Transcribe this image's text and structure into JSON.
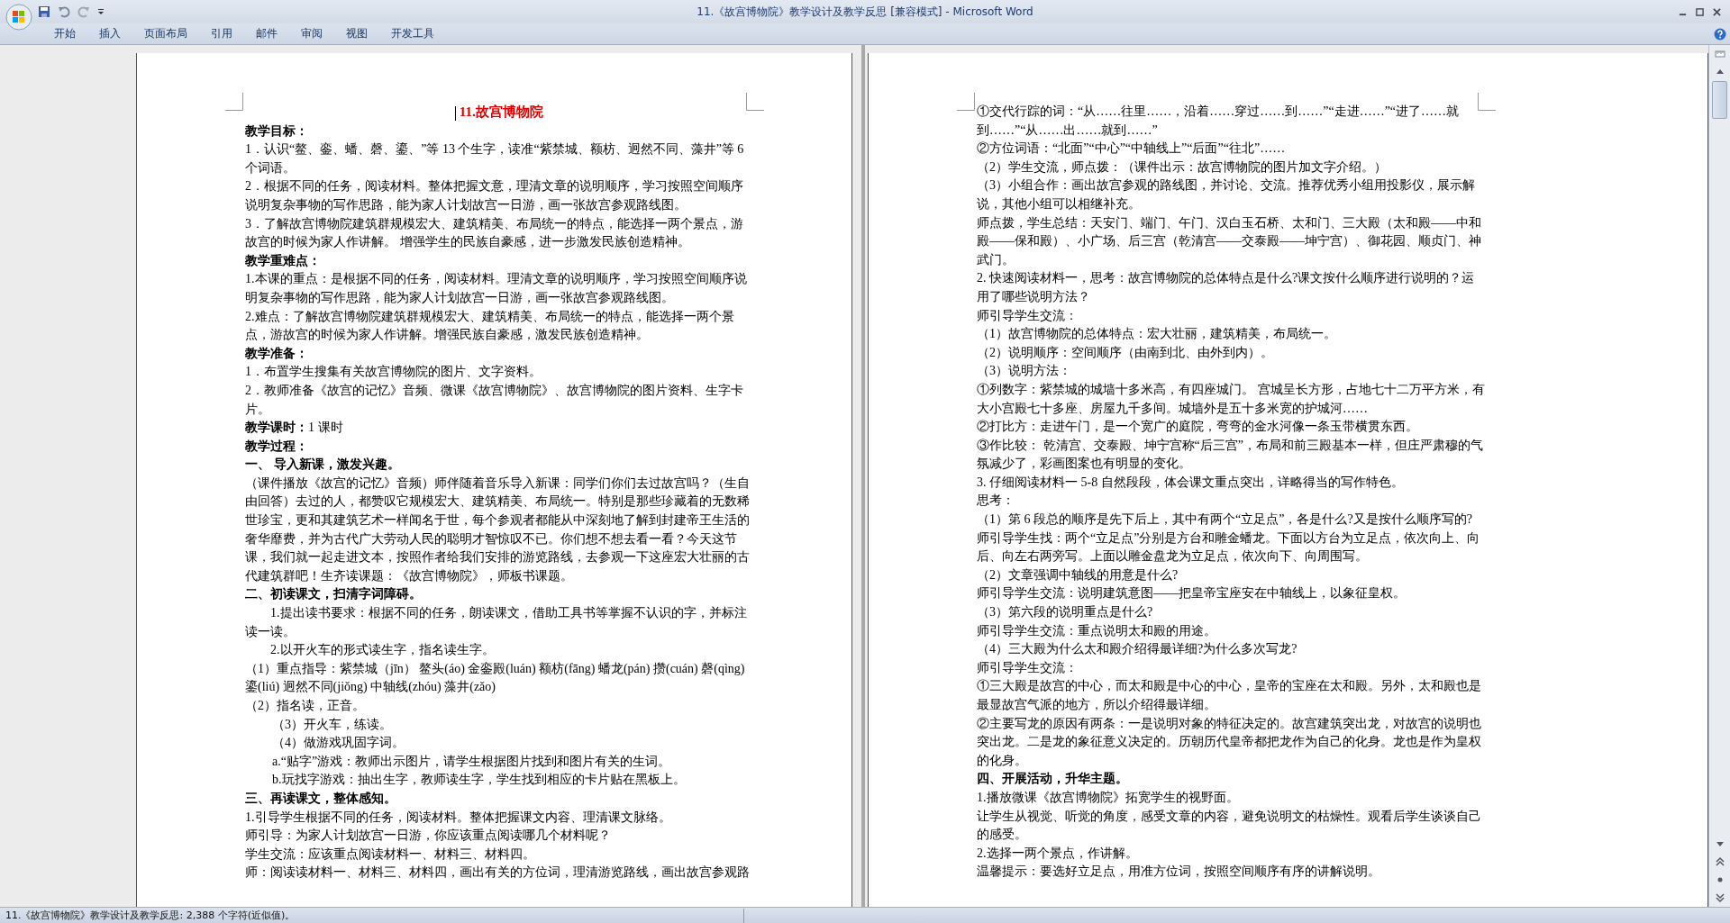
{
  "window": {
    "title": "11.《故宫博物院》教学设计及教学反思 [兼容模式] - Microsoft Word"
  },
  "ribbon_tabs": [
    "开始",
    "插入",
    "页面布局",
    "引用",
    "邮件",
    "审阅",
    "视图",
    "开发工具"
  ],
  "left_page": {
    "paragraphs": [
      {
        "kind": "title",
        "text": "11.故宫博物院"
      },
      {
        "kind": "heading",
        "text": "教学目标："
      },
      {
        "kind": "body",
        "text": "1．认识“鳌、銮、蟠、磬、鎏、”等 13 个生字，读准“紫禁城、额枋、迥然不同、藻井”等 6 个词语。"
      },
      {
        "kind": "body",
        "text": "2．根据不同的任务，阅读材料。整体把握文意，理清文章的说明顺序，学习按照空间顺序说明复杂事物的写作思路，能为家人计划故宫一日游，画一张故宫参观路线图。"
      },
      {
        "kind": "body",
        "text": "3．了解故宫博物院建筑群规模宏大、建筑精美、布局统一的特点，能选择一两个景点，游故宫的时候为家人作讲解。 增强学生的民族自豪感，进一步激发民族创造精神。"
      },
      {
        "kind": "heading",
        "text": "教学重难点："
      },
      {
        "kind": "body",
        "text": "1.本课的重点：是根据不同的任务，阅读材料。理清文章的说明顺序，学习按照空间顺序说明复杂事物的写作思路，能为家人计划故宫一日游，画一张故宫参观路线图。"
      },
      {
        "kind": "body",
        "text": "2.难点：了解故宫博物院建筑群规模宏大、建筑精美、布局统一的特点，能选择一两个景点，游故宫的时候为家人作讲解。增强民族自豪感，激发民族创造精神。"
      },
      {
        "kind": "heading",
        "text": "教学准备："
      },
      {
        "kind": "body",
        "text": "1．布置学生搜集有关故宫博物院的图片、文字资料。"
      },
      {
        "kind": "body",
        "text": "2．教师准备《故宫的记忆》音频、微课《故宫博物院》、故宫博物院的图片资料、生字卡片。"
      },
      {
        "kind": "body",
        "text": "**教学课时：**1 课时"
      },
      {
        "kind": "heading",
        "text": "教学过程："
      },
      {
        "kind": "heading",
        "text": "一、 导入新课，激发兴趣。"
      },
      {
        "kind": "body",
        "text": "（课件播放《故宫的记忆》音频）师伴随着音乐导入新课：同学们你们去过故宫吗？（生自由回答）去过的人，都赞叹它规模宏大、建筑精美、布局统一。特别是那些珍藏着的无数稀世珍宝，更和其建筑艺术一样闻名于世，每个参观者都能从中深刻地了解到封建帝王生活的奢华靡费，并为古代广大劳动人民的聪明才智惊叹不已。你们想不想去看一看？今天这节课，我们就一起走进文本，按照作者给我们安排的游览路线，去参观一下这座宏大壮丽的古代建筑群吧！生齐读课题：《故宫博物院》，师板书课题。"
      },
      {
        "kind": "heading",
        "text": "二、初读课文，扫清字词障碍。"
      },
      {
        "kind": "first_indent",
        "text": "1.提出读书要求：根据不同的任务，朗读课文，借助工具书等掌握不认识的字，并标注读一读。"
      },
      {
        "kind": "first_indent",
        "text": "2.以开火车的形式读生字，指名读生字。"
      },
      {
        "kind": "body",
        "text": "（1）重点指导：紫禁城（jīn） 鳌头(áo) 金銮殿(luán) 额枋(fāng) 蟠龙(pán) 攒(cuán) 磬(qìng) 鎏(liú) 迥然不同(jiǒng) 中轴线(zhóu) 藻井(zǎo)"
      },
      {
        "kind": "body",
        "text": "（2）指名读，正音。"
      },
      {
        "kind": "indented",
        "text": "（3）开火车，练读。"
      },
      {
        "kind": "indented",
        "text": "（4）做游戏巩固字词。"
      },
      {
        "kind": "indented",
        "text": "a.“贴字”游戏：教师出示图片，请学生根据图片找到和图片有关的生词。"
      },
      {
        "kind": "indented",
        "text": "b.玩找字游戏：抽出生字，教师读生字，学生找到相应的卡片贴在黑板上。"
      },
      {
        "kind": "heading",
        "text": "三、再读课文，整体感知。"
      },
      {
        "kind": "body",
        "text": "1.引导学生根据不同的任务，阅读材料。整体把握课文内容、理清课文脉络。"
      },
      {
        "kind": "body",
        "text": "师引导：为家人计划故宫一日游，你应该重点阅读哪几个材料呢？"
      },
      {
        "kind": "body",
        "text": "学生交流：应该重点阅读材料一、材料三、材料四。"
      },
      {
        "kind": "body_cut",
        "text": "师：阅读读材料一、材料三、材料四，画出有关的方位词，理清游览路线，画出故宫参观路"
      }
    ]
  },
  "right_page": {
    "paragraphs": [
      {
        "kind": "body",
        "text": "①交代行踪的词：“从……往里……，沿着……穿过……到……”“走进……”“进了……就到……”“从……出……就到……”"
      },
      {
        "kind": "body",
        "text": "②方位词语：“北面”“中心”“中轴线上”“后面”“往北”……"
      },
      {
        "kind": "body",
        "text": "（2）学生交流，师点拨：（课件出示：故宫博物院的图片加文字介绍。）"
      },
      {
        "kind": "body",
        "text": "（3）小组合作：画出故宫参观的路线图，并讨论、交流。推荐优秀小组用投影仪，展示解说，其他小组可以相继补充。"
      },
      {
        "kind": "body",
        "text": "师点拨，学生总结：天安门、端门、午门、汉白玉石桥、太和门、三大殿（太和殿——中和殿——保和殿）、小广场、后三宫（乾清宫——交泰殿——坤宁宫）、御花园、顺贞门、神武门。"
      },
      {
        "kind": "body",
        "text": "2. 快速阅读材料一，思考：故宫博物院的总体特点是什么?课文按什么顺序进行说明的？运用了哪些说明方法？"
      },
      {
        "kind": "body",
        "text": "师引导学生交流："
      },
      {
        "kind": "body",
        "text": "（1）故宫博物院的总体特点：宏大壮丽，建筑精美，布局统一。"
      },
      {
        "kind": "body",
        "text": "（2）说明顺序：空间顺序（由南到北、由外到内）。"
      },
      {
        "kind": "body",
        "text": "（3）说明方法："
      },
      {
        "kind": "body",
        "text": "①列数字：紫禁城的城墙十多米高，有四座城门。 宫城呈长方形，占地七十二万平方米，有大小宫殿七十多座、房屋九千多间。城墙外是五十多米宽的护城河……"
      },
      {
        "kind": "body",
        "text": "②打比方：走进午门，是一个宽广的庭院，弯弯的金水河像一条玉带横贯东西。"
      },
      {
        "kind": "body",
        "text": "③作比较： 乾清宫、交泰殿、坤宁宫称“后三宫”，布局和前三殿基本一样，但庄严肃穆的气氛减少了，彩画图案也有明显的变化。"
      },
      {
        "kind": "body",
        "text": "3. 仔细阅读材料一 5-8 自然段段，体会课文重点突出，详略得当的写作特色。"
      },
      {
        "kind": "body",
        "text": "思考："
      },
      {
        "kind": "body",
        "text": "（1）第 6 段总的顺序是先下后上，其中有两个“立足点”，各是什么?又是按什么顺序写的?"
      },
      {
        "kind": "body",
        "text": "师引导学生找：两个“立足点”分别是方台和雕金蟠龙。下面以方台为立足点，依次向上、向后、向左右两旁写。上面以雕金盘龙为立足点，依次向下、向周围写。"
      },
      {
        "kind": "body",
        "text": "（2）文章强调中轴线的用意是什么?"
      },
      {
        "kind": "body",
        "text": "师引导学生交流：说明建筑意图——把皇帝宝座安在中轴线上，以象征皇权。"
      },
      {
        "kind": "body",
        "text": "（3）第六段的说明重点是什么?"
      },
      {
        "kind": "body",
        "text": "师引导学生交流：重点说明太和殿的用途。"
      },
      {
        "kind": "body",
        "text": "（4）三大殿为什么太和殿介绍得最详细?为什么多次写龙?"
      },
      {
        "kind": "body",
        "text": "师引导学生交流："
      },
      {
        "kind": "body",
        "text": "①三大殿是故宫的中心，而太和殿是中心的中心，皇帝的宝座在太和殿。另外，太和殿也是最显故宫气派的地方，所以介绍得最详细。"
      },
      {
        "kind": "body",
        "text": "②主要写龙的原因有两条：一是说明对象的特征决定的。故宫建筑突出龙，对故宫的说明也突出龙。二是龙的象征意义决定的。历朝历代皇帝都把龙作为自己的化身。龙也是作为皇权的化身。"
      },
      {
        "kind": "heading",
        "text": "四、开展活动，升华主题。"
      },
      {
        "kind": "body",
        "text": "1.播放微课《故宫博物院》拓宽学生的视野面。"
      },
      {
        "kind": "body",
        "text": "让学生从视觉、听觉的角度，感受文章的内容，避免说明文的枯燥性。观看后学生谈谈自己的感受。"
      },
      {
        "kind": "body",
        "text": "2.选择一两个景点，作讲解。"
      },
      {
        "kind": "body",
        "text": "温馨提示：要选好立足点，用准方位词，按照空间顺序有序的讲解说明。"
      }
    ]
  },
  "status_bar": {
    "text": "11.《故宫博物院》教学设计及教学反思: 2,388 个字符(近似值)。"
  }
}
